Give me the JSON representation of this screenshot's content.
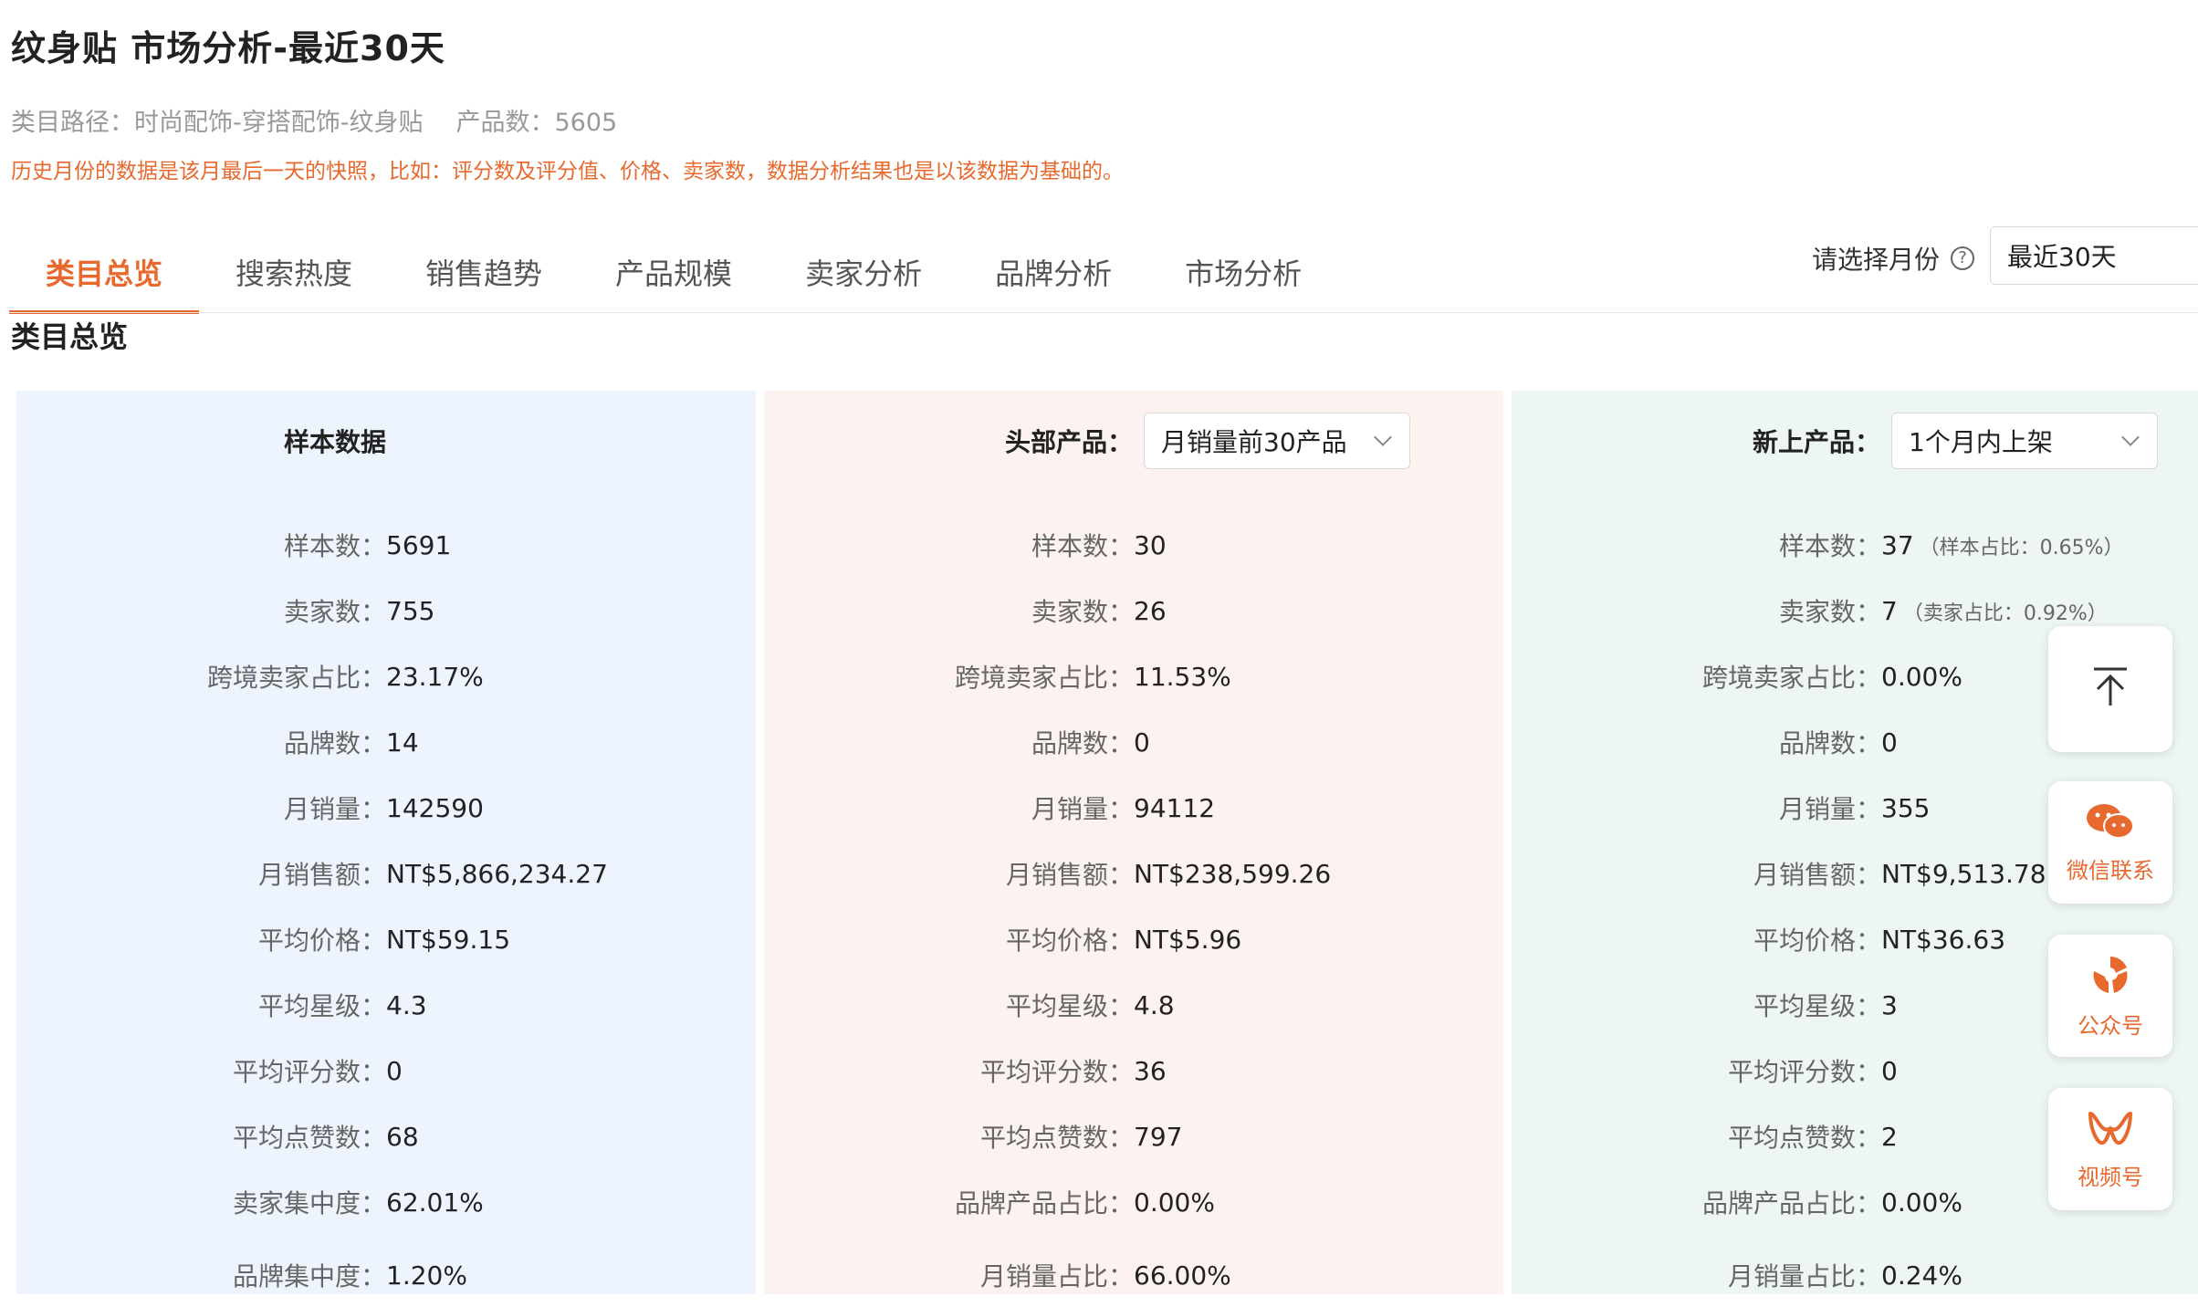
{
  "header": {
    "title": "纹身贴 市场分析-最近30天",
    "category_path_label": "类目路径：",
    "category_path": "时尚配饰-穿搭配饰-纹身贴",
    "product_count_label": "产品数：",
    "product_count": "5605",
    "notice": "历史月份的数据是该月最后一天的快照，比如：评分数及评分值、价格、卖家数，数据分析结果也是以该数据为基础的。"
  },
  "tabs": [
    "类目总览",
    "搜索热度",
    "销售趋势",
    "产品规模",
    "卖家分析",
    "品牌分析",
    "市场分析"
  ],
  "month_picker": {
    "label": "请选择月份",
    "help_icon": "question-circle-icon",
    "value": "最近30天"
  },
  "section_title": "类目总览",
  "panels": {
    "sample": {
      "title": "样本数据",
      "rows": [
        {
          "k": "样本数：",
          "v": "5691"
        },
        {
          "k": "卖家数：",
          "v": "755"
        },
        {
          "k": "跨境卖家占比：",
          "v": "23.17%"
        },
        {
          "k": "品牌数：",
          "v": "14"
        },
        {
          "k": "月销量：",
          "v": "142590"
        },
        {
          "k": "月销售额：",
          "v": "NT$5,866,234.27"
        },
        {
          "k": "平均价格：",
          "v": "NT$59.15"
        },
        {
          "k": "平均星级：",
          "v": "4.3"
        },
        {
          "k": "平均评分数：",
          "v": "0"
        },
        {
          "k": "平均点赞数：",
          "v": "68"
        },
        {
          "k": "卖家集中度：",
          "v": "62.01%"
        },
        {
          "k": "品牌集中度：",
          "v": "1.20%"
        }
      ]
    },
    "top": {
      "title": "头部产品：",
      "dropdown": "月销量前30产品",
      "rows": [
        {
          "k": "样本数：",
          "v": "30"
        },
        {
          "k": "卖家数：",
          "v": "26"
        },
        {
          "k": "跨境卖家占比：",
          "v": "11.53%"
        },
        {
          "k": "品牌数：",
          "v": "0"
        },
        {
          "k": "月销量：",
          "v": "94112"
        },
        {
          "k": "月销售额：",
          "v": "NT$238,599.26"
        },
        {
          "k": "平均价格：",
          "v": "NT$5.96"
        },
        {
          "k": "平均星级：",
          "v": "4.8"
        },
        {
          "k": "平均评分数：",
          "v": "36"
        },
        {
          "k": "平均点赞数：",
          "v": "797"
        },
        {
          "k": "品牌产品占比：",
          "v": "0.00%"
        },
        {
          "k": "月销量占比：",
          "v": "66.00%"
        }
      ]
    },
    "new": {
      "title": "新上产品：",
      "dropdown": "1个月内上架",
      "rows": [
        {
          "k": "样本数：",
          "v": "37",
          "sub": "（样本占比：0.65%）"
        },
        {
          "k": "卖家数：",
          "v": "7",
          "sub": "（卖家占比：0.92%）"
        },
        {
          "k": "跨境卖家占比：",
          "v": "0.00%"
        },
        {
          "k": "品牌数：",
          "v": "0"
        },
        {
          "k": "月销量：",
          "v": "355"
        },
        {
          "k": "月销售额：",
          "v": "NT$9,513.78"
        },
        {
          "k": "平均价格：",
          "v": "NT$36.63"
        },
        {
          "k": "平均星级：",
          "v": "3"
        },
        {
          "k": "平均评分数：",
          "v": "0"
        },
        {
          "k": "平均点赞数：",
          "v": "2"
        },
        {
          "k": "品牌产品占比：",
          "v": "0.00%"
        },
        {
          "k": "月销量占比：",
          "v": "0.24%"
        }
      ]
    }
  },
  "float_buttons": [
    {
      "icon": "arrow-to-top-icon",
      "label": ""
    },
    {
      "icon": "wechat-icon",
      "label": "微信联系"
    },
    {
      "icon": "official-account-icon",
      "label": "公众号"
    },
    {
      "icon": "video-channel-icon",
      "label": "视频号"
    }
  ],
  "colors": {
    "accent": "#e8692e",
    "panel_blue": "#eef4fd",
    "panel_pink": "#fcf2ef",
    "panel_green": "#eef6f3"
  }
}
